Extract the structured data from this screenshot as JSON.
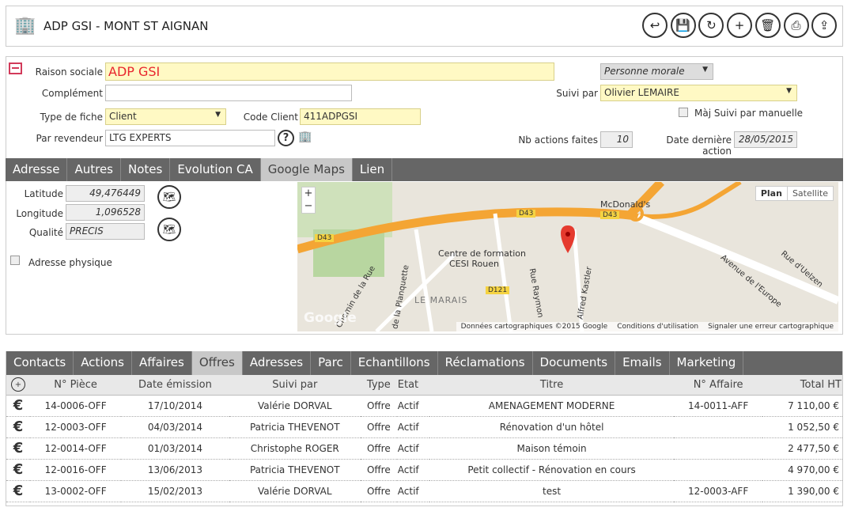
{
  "header": {
    "title": "ADP GSI - MONT ST AIGNAN",
    "icon": "building-icon",
    "actions": [
      {
        "name": "back",
        "glyph": "↩"
      },
      {
        "name": "save",
        "glyph": "💾"
      },
      {
        "name": "refresh",
        "glyph": "↻"
      },
      {
        "name": "new-document",
        "glyph": "+"
      },
      {
        "name": "delete",
        "glyph": "🗑"
      },
      {
        "name": "print",
        "glyph": "⎙"
      },
      {
        "name": "export",
        "glyph": "⇪"
      }
    ]
  },
  "form": {
    "raison_sociale_label": "Raison sociale",
    "raison_sociale": "ADP GSI",
    "complement_label": "Complément",
    "complement": "",
    "type_fiche_label": "Type de fiche",
    "type_fiche": "Client",
    "code_client_label": "Code Client",
    "code_client": "411ADPGSI",
    "revendeur_label": "Par revendeur",
    "revendeur": "LTG EXPERTS",
    "personne": "Personne morale",
    "suivi_label": "Suivi par",
    "suivi": "Olivier LEMAIRE",
    "maj_label": "Màj Suivi par manuelle",
    "nb_actions_label": "Nb actions faites",
    "nb_actions": "10",
    "date_action_label": "Date dernière action",
    "date_action": "28/05/2015"
  },
  "tabs1": [
    "Adresse",
    "Autres",
    "Notes",
    "Evolution CA",
    "Google Maps",
    "Lien"
  ],
  "tabs1_active": 4,
  "geo": {
    "lat_label": "Latitude",
    "lat": "49,476449",
    "lon_label": "Longitude",
    "lon": "1,096528",
    "qual_label": "Qualité",
    "qual": "PRECIS",
    "phys_label": "Adresse physique"
  },
  "map": {
    "plan": "Plan",
    "satellite": "Satellite",
    "zoom_in": "+",
    "zoom_out": "−",
    "labels": [
      "D43",
      "D43",
      "D43",
      "McDonald's",
      "Centre de formation",
      "CESI Rouen",
      "LE MARAIS",
      "D121",
      "Chemin de la Rue",
      "de la Planquette",
      "Rue Raymon",
      "Alfred Kastler",
      "Avenue de l'Europe",
      "Rue d'Uelzen",
      "Google"
    ],
    "footer": [
      "Données cartographiques ©2015 Google",
      "Conditions d'utilisation",
      "Signaler une erreur cartographique"
    ]
  },
  "tabs2": [
    "Contacts",
    "Actions",
    "Affaires",
    "Offres",
    "Adresses",
    "Parc",
    "Echantillons",
    "Réclamations",
    "Documents",
    "Emails",
    "Marketing"
  ],
  "tabs2_active": 3,
  "table": {
    "columns": [
      "N° Pièce",
      "Date émission",
      "Suivi par",
      "Type",
      "Etat",
      "Titre",
      "N° Affaire",
      "Total HT"
    ],
    "rows": [
      [
        "14-0006-OFF",
        "17/10/2014",
        "Valérie DORVAL",
        "Offre",
        "Actif",
        "AMENAGEMENT MODERNE",
        "14-0011-AFF",
        "7 110,00 €"
      ],
      [
        "12-0003-OFF",
        "04/03/2014",
        "Patricia THEVENOT",
        "Offre",
        "Actif",
        "Rénovation d'un hôtel",
        "",
        "1 052,50 €"
      ],
      [
        "12-0014-OFF",
        "01/03/2014",
        "Christophe ROGER",
        "Offre",
        "Actif",
        "Maison témoin",
        "",
        "2 477,50 €"
      ],
      [
        "12-0016-OFF",
        "13/06/2013",
        "Patricia THEVENOT",
        "Offre",
        "Actif",
        "Petit collectif - Rénovation en cours",
        "",
        "4 970,00 €"
      ],
      [
        "13-0002-OFF",
        "15/02/2013",
        "Valérie DORVAL",
        "Offre",
        "Actif",
        "test",
        "12-0003-AFF",
        "1 390,00 €"
      ]
    ]
  }
}
